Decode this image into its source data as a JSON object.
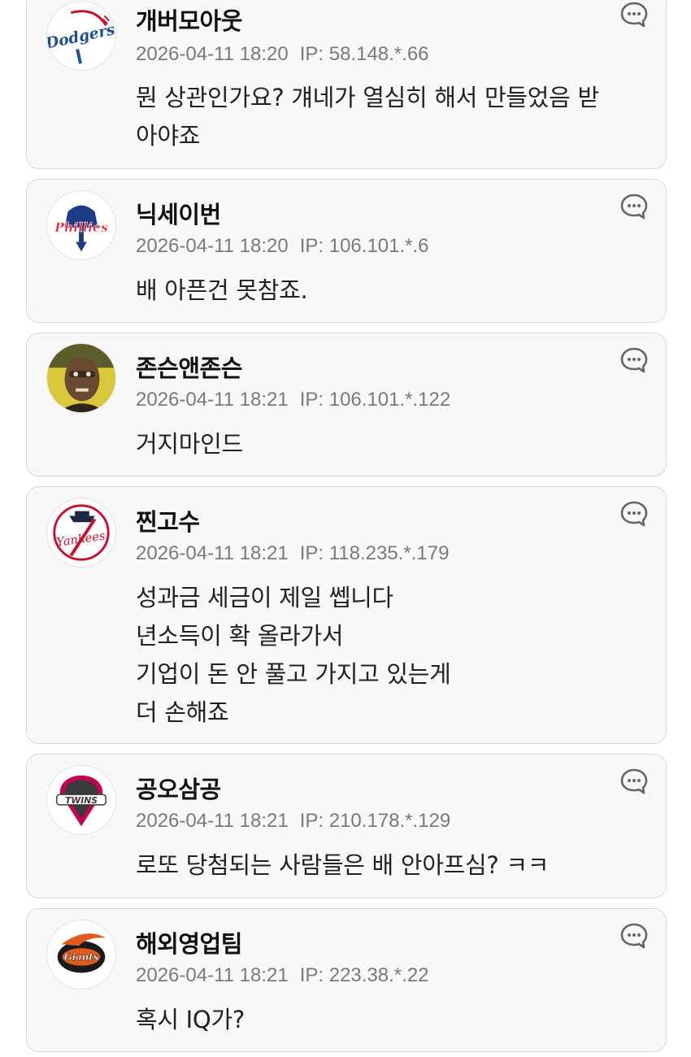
{
  "comments": [
    {
      "nickname": "개버모아웃",
      "date": "2026-04-11 18:20",
      "ip": "IP: 58.148.*.66",
      "lines": [
        "뭔 상관인가요? 걔네가 열심히 해서 만들었음 받",
        "아야죠"
      ],
      "avatar": "dodgers-logo",
      "avatar_text": "Dodgers"
    },
    {
      "nickname": "닉세이번",
      "date": "2026-04-11 18:20",
      "ip": "IP: 106.101.*.6",
      "lines": [
        "배 아픈건 못참죠."
      ],
      "avatar": "phillies-logo",
      "avatar_text": "Phillies"
    },
    {
      "nickname": "존슨앤존슨",
      "date": "2026-04-11 18:21",
      "ip": "IP: 106.101.*.122",
      "lines": [
        "거지마인드"
      ],
      "avatar": "person-photo",
      "avatar_text": ""
    },
    {
      "nickname": "찐고수",
      "date": "2026-04-11 18:21",
      "ip": "IP: 118.235.*.179",
      "lines": [
        "성과금 세금이 제일 쎕니다",
        "년소득이 확 올라가서",
        "기업이 돈 안 풀고 가지고 있는게",
        "더 손해죠"
      ],
      "avatar": "yankees-logo",
      "avatar_text": "Yankees"
    },
    {
      "nickname": "공오삼공",
      "date": "2026-04-11 18:21",
      "ip": "IP: 210.178.*.129",
      "lines": [
        "로또 당첨되는 사람들은 배 안아프심? ㅋㅋ"
      ],
      "avatar": "lg-twins-logo",
      "avatar_text": "TWINS"
    },
    {
      "nickname": "해외영업팀",
      "date": "2026-04-11 18:21",
      "ip": "IP: 223.38.*.22",
      "lines": [
        "혹시 IQ가?"
      ],
      "avatar": "giants-logo",
      "avatar_text": "Giants"
    }
  ],
  "icons": {
    "reply": "comment-bubble-icon"
  },
  "colors": {
    "card_bg": "#f8f8f8",
    "card_border": "#d9d9d9",
    "meta": "#7a7a7a"
  }
}
